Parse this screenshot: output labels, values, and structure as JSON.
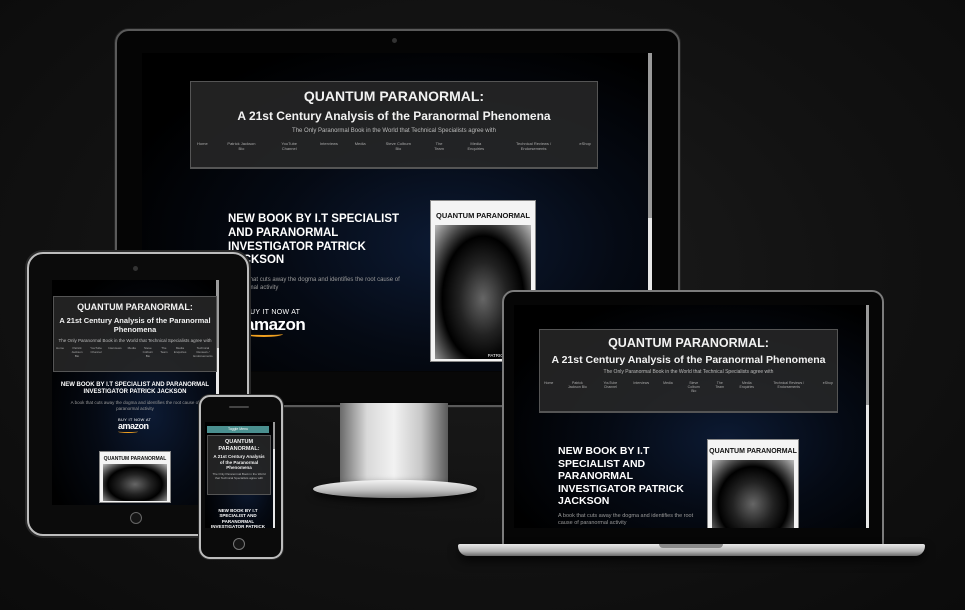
{
  "site": {
    "title": "QUANTUM PARANORMAL:",
    "subtitle": "A 21st Century Analysis of the Paranormal Phenomena",
    "tagline": "The Only Paranormal Book in the World that Technical Specialists agree with",
    "nav": [
      "Home",
      "Patrick Jackson Bio",
      "YouTube Channel",
      "Interviews",
      "Media",
      "Steve Colburn Bio",
      "The Team",
      "Media Enquiries",
      "Technical Reviews / Endorsements",
      "eShop"
    ],
    "hero_title": "NEW BOOK BY I.T SPECIALIST AND PARANORMAL INVESTIGATOR PATRICK JACKSON",
    "hero_text": "A book that cuts away the dogma and identifies the root cause of paranormal activity",
    "buy_label": "BUY IT NOW AT",
    "amazon_label": "amazon",
    "cover_title": "QUANTUM PARANORMAL",
    "cover_author": "PATRICK JACKSON",
    "mobile_toggle": "Toggle Menu"
  },
  "devices": [
    "desktop-monitor",
    "tablet",
    "smartphone",
    "laptop"
  ]
}
